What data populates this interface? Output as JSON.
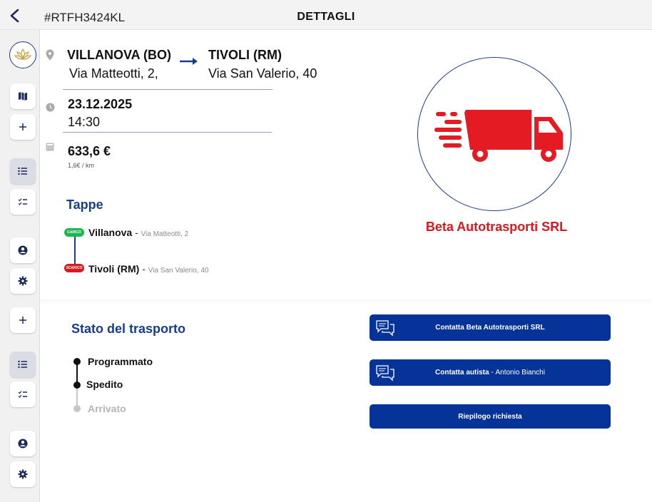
{
  "header": {
    "code": "#RTFH3424KL",
    "title": "DETTAGLI"
  },
  "sidebar": {
    "items": [
      {
        "icon": "map-icon"
      },
      {
        "icon": "plus-icon"
      },
      {
        "icon": "list-icon",
        "active": true
      },
      {
        "icon": "checklist-icon"
      },
      {
        "icon": "user-icon"
      },
      {
        "icon": "gear-icon"
      },
      {
        "icon": "plus-icon"
      },
      {
        "icon": "list-icon",
        "active": true
      },
      {
        "icon": "checklist-icon"
      },
      {
        "icon": "user-icon"
      },
      {
        "icon": "gear-icon"
      }
    ]
  },
  "route": {
    "from_city": "VILLANOVA (BO)",
    "from_address": "Via Matteotti, 2,",
    "to_city": "TIVOLI (RM)",
    "to_address": "Via San Valerio, 40"
  },
  "schedule": {
    "date": "23.12.2025",
    "time": "14:30"
  },
  "price": {
    "amount": "633,6 €",
    "rate": "1,6€ / km"
  },
  "tappe": {
    "title": "Tappe",
    "stops": [
      {
        "badge": "CARICO",
        "city": "Villanova",
        "separator": "-",
        "address": "Via Matteotti, 2",
        "color": "#1fb552"
      },
      {
        "badge": "SCARICO",
        "city": "Tivoli (RM)",
        "separator": "-",
        "address": "Via San Valerio, 40",
        "color": "#d71920"
      }
    ]
  },
  "carrier": {
    "name": "Beta Autotrasporti SRL",
    "color": "#d71920"
  },
  "status": {
    "title": "Stato del trasporto",
    "steps": [
      {
        "label": "Programmato",
        "done": true
      },
      {
        "label": "Spedito",
        "done": true
      },
      {
        "label": "Arrivato",
        "done": false
      }
    ]
  },
  "actions": {
    "contact_company": "Contatta Beta Autotrasporti SRL",
    "contact_driver_label": "Contatta autista",
    "contact_driver_separator": " - ",
    "contact_driver_name": "Antonio Bianchi",
    "summary": "Riepilogo richiesta"
  },
  "colors": {
    "primary": "#063397",
    "title_blue": "#163e8f",
    "accent_red": "#d71920",
    "carico_green": "#1fb552"
  }
}
